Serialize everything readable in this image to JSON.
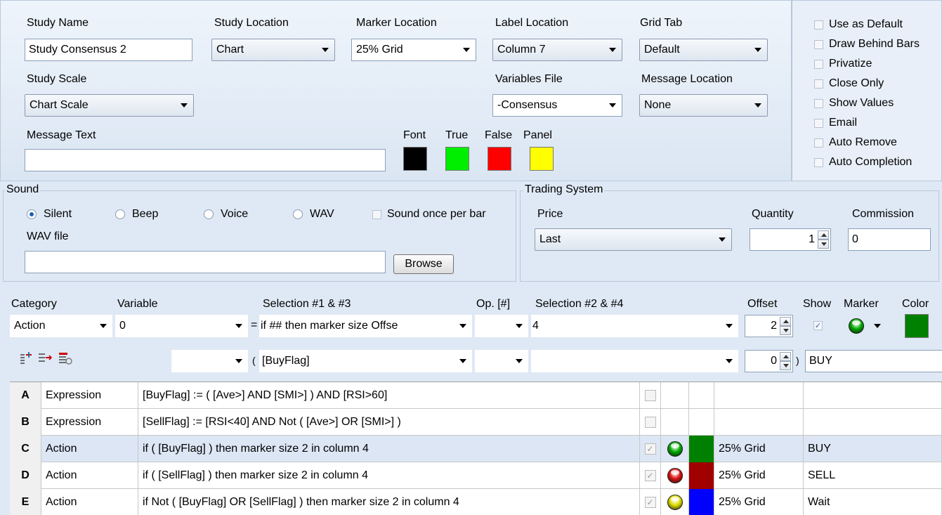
{
  "study": {
    "name_label": "Study Name",
    "name_value": "Study Consensus 2",
    "location_label": "Study Location",
    "location_value": "Chart",
    "marker_location_label": "Marker Location",
    "marker_location_value": "25% Grid",
    "label_location_label": "Label Location",
    "label_location_value": "Column 7",
    "grid_tab_label": "Grid Tab",
    "grid_tab_value": "Default",
    "scale_label": "Study Scale",
    "scale_value": "Chart Scale",
    "variables_file_label": "Variables File",
    "variables_file_value": "-Consensus",
    "message_location_label": "Message Location",
    "message_location_value": "None",
    "message_text_label": "Message Text",
    "message_text_value": ""
  },
  "colors": {
    "labels": [
      "Font",
      "True",
      "False",
      "Panel"
    ],
    "values": [
      "#000000",
      "#00ee00",
      "#ff0000",
      "#ffff00"
    ]
  },
  "options": [
    "Use as Default",
    "Draw Behind Bars",
    "Privatize",
    "Close Only",
    "Show Values",
    "Email",
    "Auto Remove",
    "Auto Completion"
  ],
  "sound": {
    "title": "Sound",
    "radios": [
      "Silent",
      "Beep",
      "Voice",
      "WAV"
    ],
    "selected": "Silent",
    "once_per_bar": "Sound once per bar",
    "wav_label": "WAV file",
    "wav_value": "",
    "browse": "Browse"
  },
  "trading": {
    "title": "Trading System",
    "price_label": "Price",
    "price_value": "Last",
    "quantity_label": "Quantity",
    "quantity_value": "1",
    "commission_label": "Commission",
    "commission_value": "0"
  },
  "editor": {
    "headers": {
      "category": "Category",
      "variable": "Variable",
      "sel13": "Selection #1 & #3",
      "op": "Op. [#]",
      "sel24": "Selection #2 & #4",
      "offset": "Offset",
      "show": "Show",
      "marker": "Marker",
      "color": "Color"
    },
    "row1": {
      "category": "Action",
      "variable": "0",
      "eq": "=",
      "sel13": "if ## then marker size Offse",
      "op": "",
      "sel24": "4",
      "offset": "2",
      "marker_color": "#00aa00",
      "color": "#008000"
    },
    "row2": {
      "paren_open": "(",
      "sel13": "[BuyFlag]",
      "op": "",
      "sel24": "",
      "offset": "0",
      "paren_close": ")",
      "text": "BUY"
    }
  },
  "table": [
    {
      "id": "A",
      "type": "Expression",
      "formula": "[BuyFlag] := ( [Ave>] AND [SMI>] ) AND [RSI>60]",
      "checked": false,
      "marker": "",
      "color": "",
      "location": "",
      "label": ""
    },
    {
      "id": "B",
      "type": "Expression",
      "formula": "[SellFlag] := [RSI<40] AND Not ( [Ave>] OR [SMI>] )",
      "checked": false,
      "marker": "",
      "color": "",
      "location": "",
      "label": ""
    },
    {
      "id": "C",
      "type": "Action",
      "formula": "if ( [BuyFlag] ) then marker size 2 in column 4",
      "checked": true,
      "marker": "#00aa00",
      "color": "#008000",
      "location": "25% Grid",
      "label": "BUY"
    },
    {
      "id": "D",
      "type": "Action",
      "formula": "if ( [SellFlag] ) then marker size 2 in column 4",
      "checked": true,
      "marker": "#dd1111",
      "color": "#a00000",
      "location": "25% Grid",
      "label": "SELL"
    },
    {
      "id": "E",
      "type": "Action",
      "formula": "if  Not ( [BuyFlag] OR [SellFlag] ) then marker size 2 in column 4",
      "checked": true,
      "marker": "#dddd00",
      "color": "#0000ff",
      "location": "25% Grid",
      "label": "Wait"
    }
  ]
}
